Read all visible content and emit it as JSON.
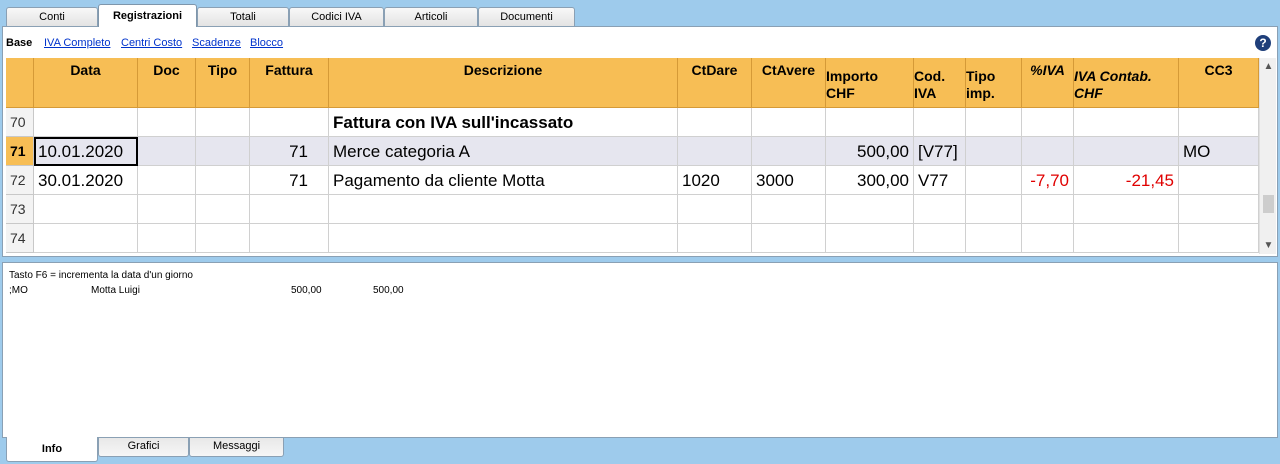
{
  "top_tabs": [
    "Conti",
    "Registrazioni",
    "Totali",
    "Codici IVA",
    "Articoli",
    "Documenti"
  ],
  "views": [
    "Base",
    "IVA Completo",
    "Centri Costo",
    "Scadenze",
    "Blocco"
  ],
  "columns": {
    "data": "Data",
    "doc": "Doc",
    "tipo": "Tipo",
    "fattura": "Fattura",
    "descrizione": "Descrizione",
    "ctdare": "CtDare",
    "ctavere": "CtAvere",
    "importo_1": "Importo",
    "importo_2": "CHF",
    "cod_1": "Cod.",
    "cod_2": "IVA",
    "tipoimp_1": "Tipo",
    "tipoimp_2": "imp.",
    "piva": "%IVA",
    "ivacontab_1": "IVA Contab.",
    "ivacontab_2": "CHF",
    "cc3": "CC3"
  },
  "rows": [
    {
      "num": "70",
      "data": "",
      "doc": "",
      "tipo": "",
      "fattura": "",
      "descrizione": "Fattura con IVA sull'incassato",
      "ctdare": "",
      "ctavere": "",
      "importo": "",
      "cod": "",
      "tipoimp": "",
      "piva": "",
      "ivacontab": "",
      "cc3": ""
    },
    {
      "num": "71",
      "data": "10.01.2020",
      "doc": "",
      "tipo": "",
      "fattura": "71",
      "descrizione": "Merce categoria A",
      "ctdare": "",
      "ctavere": "",
      "importo": "500,00",
      "cod": "[V77]",
      "tipoimp": "",
      "piva": "",
      "ivacontab": "",
      "cc3": "MO"
    },
    {
      "num": "72",
      "data": "30.01.2020",
      "doc": "",
      "tipo": "",
      "fattura": "71",
      "descrizione": "Pagamento da cliente Motta",
      "ctdare": "1020",
      "ctavere": "3000",
      "importo": "300,00",
      "cod": "V77",
      "tipoimp": "",
      "piva": "-7,70",
      "ivacontab": "-21,45",
      "cc3": ""
    },
    {
      "num": "73",
      "data": "",
      "doc": "",
      "tipo": "",
      "fattura": "",
      "descrizione": "",
      "ctdare": "",
      "ctavere": "",
      "importo": "",
      "cod": "",
      "tipoimp": "",
      "piva": "",
      "ivacontab": "",
      "cc3": ""
    },
    {
      "num": "74",
      "data": "",
      "doc": "",
      "tipo": "",
      "fattura": "",
      "descrizione": "",
      "ctdare": "",
      "ctavere": "",
      "importo": "",
      "cod": "",
      "tipoimp": "",
      "piva": "",
      "ivacontab": "",
      "cc3": ""
    }
  ],
  "info": {
    "hint": "Tasto F6 = incrementa la data d'un giorno",
    "line2": {
      "code": ";MO",
      "name": "Motta Luigi",
      "amount1": "500,00",
      "amount2": "500,00"
    }
  },
  "bottom_tabs": [
    "Info",
    "Grafici",
    "Messaggi"
  ],
  "help_glyph": "?",
  "scroll_up_glyph": "▲",
  "scroll_down_glyph": "▼",
  "colors": {
    "header": "#f7be55",
    "selected_row": "#e6e6ef",
    "negative": "#e00000",
    "link": "#0033cc"
  }
}
